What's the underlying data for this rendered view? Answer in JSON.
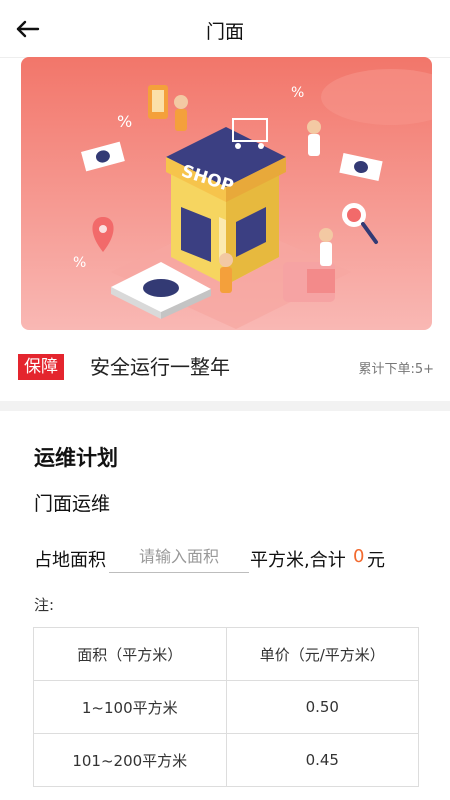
{
  "header": {
    "title": "门面",
    "back_icon": "arrow-left-icon"
  },
  "banner": {
    "sign_text": "SHOP",
    "bg_start": "#f2766a",
    "bg_end": "#f9b8b4"
  },
  "info": {
    "tag": "保障",
    "slogan": "安全运行一整年",
    "orders": "累计下单:5+",
    "tag_color": "#e4252e"
  },
  "plan": {
    "title": "运维计划",
    "subtitle": "门面运维",
    "area_label": "占地面积",
    "area_placeholder": "请输入面积",
    "unit_text": "平方米,合计",
    "total": "0",
    "currency": "元",
    "total_color": "#f26a2f",
    "note": "注:"
  },
  "table": {
    "headers": [
      "面积（平方米）",
      "单价（元/平方米）"
    ],
    "rows": [
      [
        "1~100平方米",
        "0.50"
      ],
      [
        "101~200平方米",
        "0.45"
      ]
    ]
  }
}
